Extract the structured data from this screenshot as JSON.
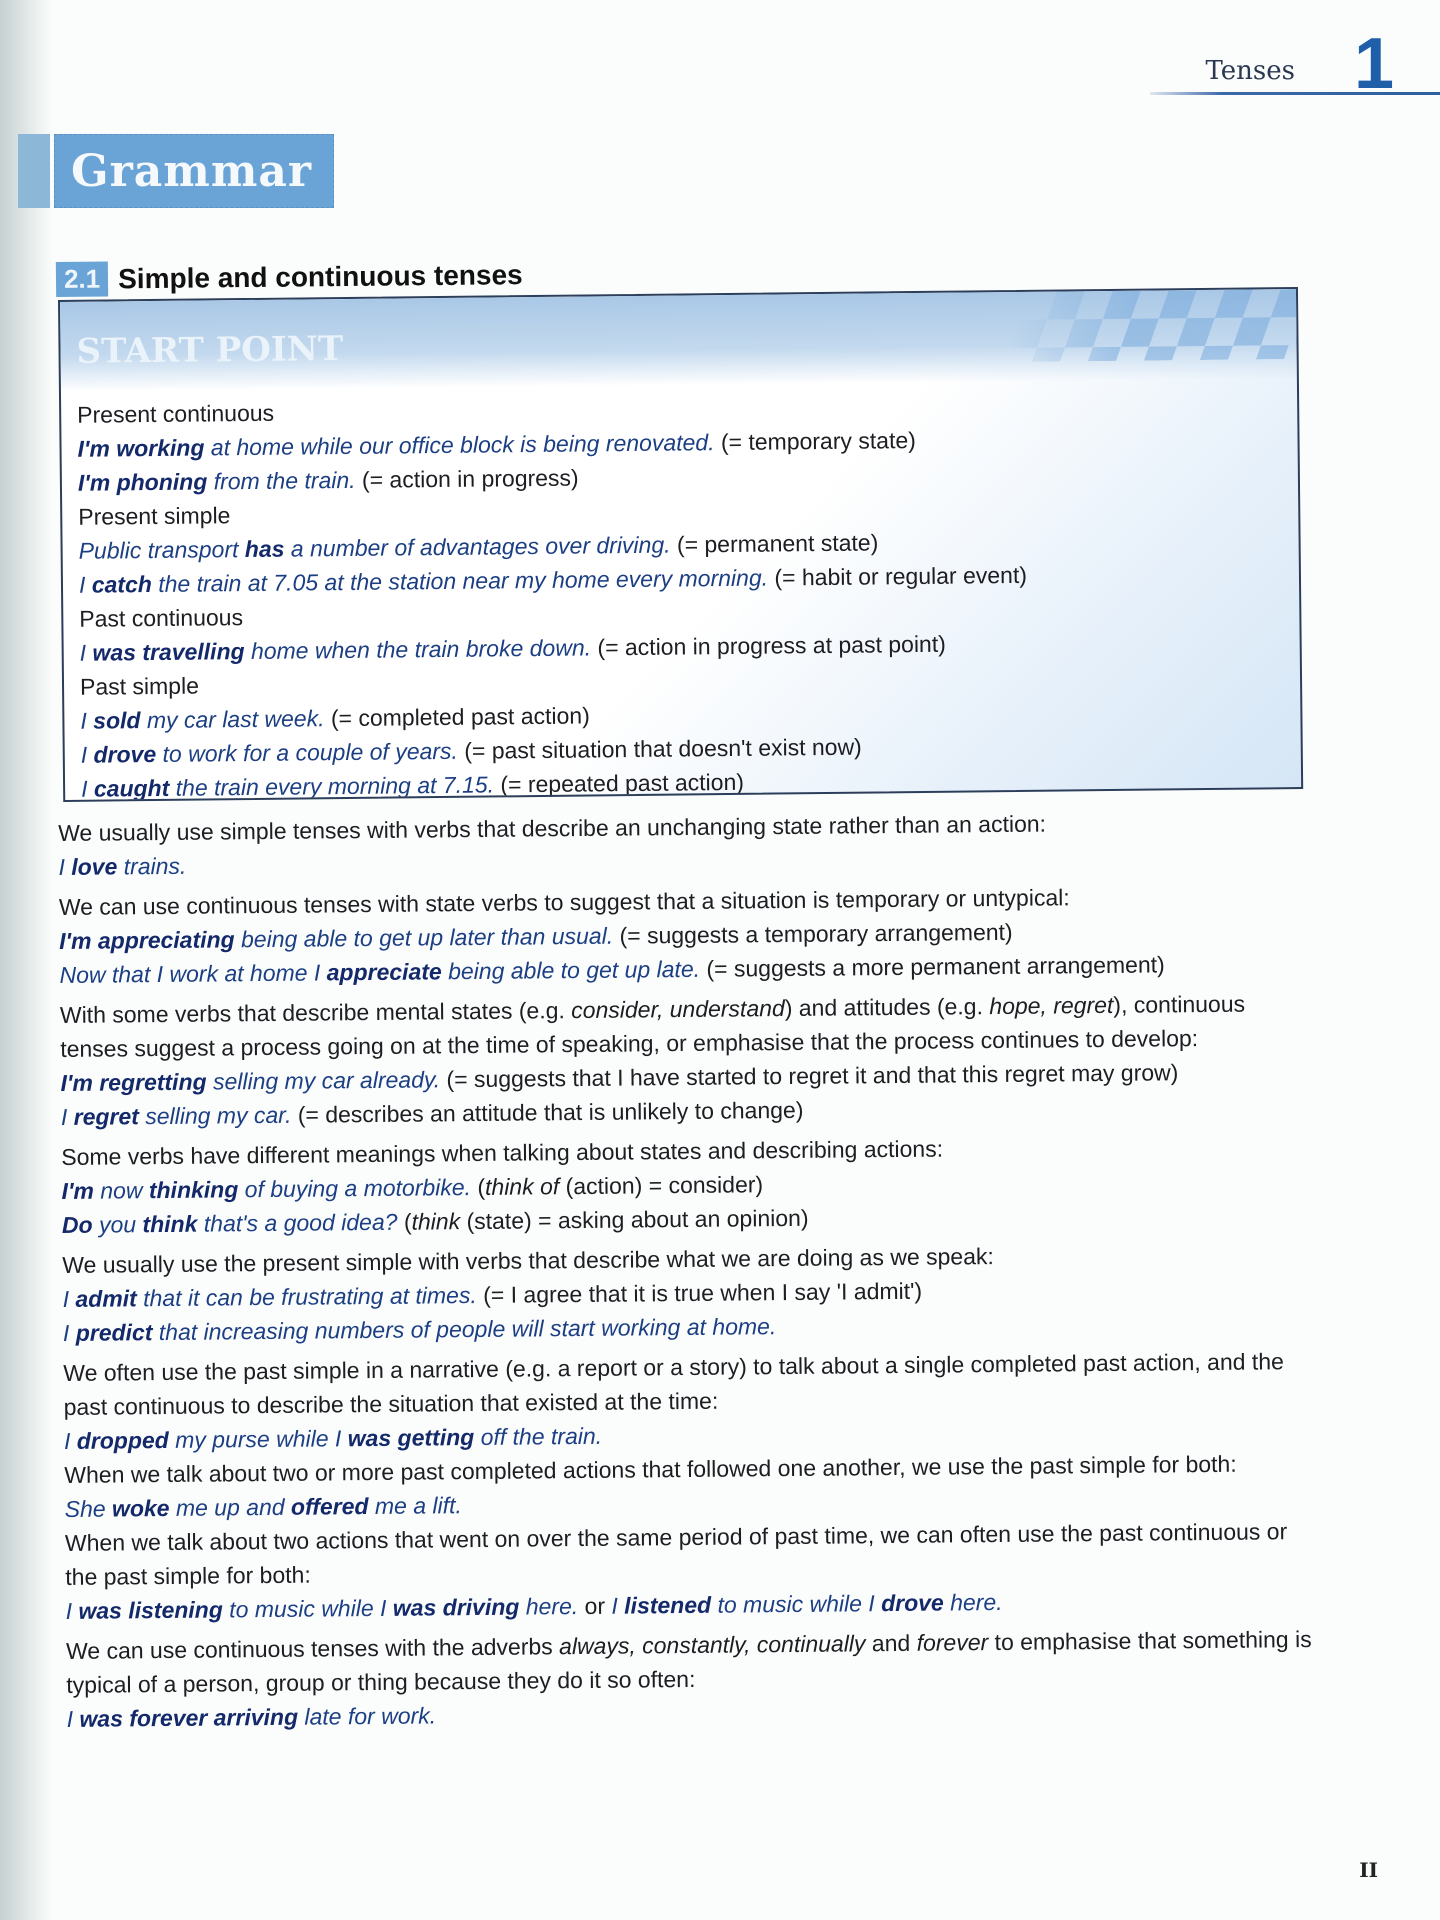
{
  "running_head": {
    "chapter_title": "Tenses",
    "chapter_number": "1"
  },
  "banner": {
    "label": "Grammar"
  },
  "section": {
    "number": "2.1",
    "title": "Simple and continuous tenses"
  },
  "start_point": {
    "title": "START POINT",
    "groups": [
      {
        "category": "Present continuous",
        "examples": [
          {
            "bold": "I'm working",
            "rest": " at home while our office block is being renovated.",
            "gloss": " (= temporary state)"
          },
          {
            "bold": "I'm phoning",
            "rest": " from the train.",
            "gloss": " (= action in progress)"
          }
        ]
      },
      {
        "category": "Present simple",
        "examples": [
          {
            "pre": "Public transport ",
            "bold": "has",
            "rest": " a number of advantages over driving.",
            "gloss": " (= permanent state)"
          },
          {
            "pre": "I ",
            "bold": "catch",
            "rest": " the train at 7.05 at the station near my home every morning.",
            "gloss": " (= habit or regular event)"
          }
        ]
      },
      {
        "category": "Past continuous",
        "examples": [
          {
            "pre": "I ",
            "bold": "was travelling",
            "rest": " home when the train broke down.",
            "gloss": " (= action in progress at past point)"
          }
        ]
      },
      {
        "category": "Past simple",
        "examples": [
          {
            "pre": "I ",
            "bold": "sold",
            "rest": " my car last week.",
            "gloss": " (= completed past action)"
          },
          {
            "pre": "I ",
            "bold": "drove",
            "rest": " to work for a couple of years.",
            "gloss": " (= past situation that doesn't exist now)"
          },
          {
            "pre": "I ",
            "bold": "caught",
            "rest": " the train every morning at 7.15.",
            "gloss": " (= repeated past action)"
          }
        ]
      }
    ]
  },
  "body": {
    "p1": "We usually use simple tenses with verbs that describe an unchanging state rather than an action:",
    "ex1": {
      "pre": "I ",
      "bold": "love",
      "rest": " trains."
    },
    "p2": "We can use continuous tenses with state verbs to suggest that a situation is temporary or untypical:",
    "ex2a": {
      "bold": "I'm appreciating",
      "rest": " being able to get up later than usual.",
      "gloss": " (= suggests a temporary arrangement)"
    },
    "ex2b": {
      "pre": "Now that I work at home I ",
      "bold": "appreciate",
      "rest": " being able to get up late.",
      "gloss": " (= suggests a more permanent arrangement)"
    },
    "p3": {
      "a": "With some verbs that describe mental states (e.g. ",
      "i1": "consider, understand",
      "b": ") and attitudes (e.g. ",
      "i2": "hope, regret",
      "c": "), continuous tenses suggest a process going on at the time of speaking, or emphasise that the process continues to develop:"
    },
    "ex3a": {
      "bold": "I'm regretting",
      "rest": " selling my car already.",
      "gloss": " (= suggests that I have started to regret it and that this regret may grow)"
    },
    "ex3b": {
      "pre": "I ",
      "bold": "regret",
      "rest": " selling my car.",
      "gloss": " (= describes an attitude that is unlikely to change)"
    },
    "p4": "Some verbs have different meanings when talking about states and describing actions:",
    "ex4a": {
      "bold1": "I'm",
      "mid": " now ",
      "bold2": "thinking",
      "rest": " of buying a motorbike.",
      "gloss_pre": " (",
      "gloss_i": "think of",
      "gloss_post": " (action) = consider)"
    },
    "ex4b": {
      "bold1": "Do",
      "mid": " you ",
      "bold2": "think",
      "rest": " that's a good idea?",
      "gloss_pre": " (",
      "gloss_i": "think",
      "gloss_post": " (state) = asking about an opinion)"
    },
    "p5": "We usually use the present simple with verbs that describe what we are doing as we speak:",
    "ex5a": {
      "pre": "I ",
      "bold": "admit",
      "rest": " that it can be frustrating at times.",
      "gloss": " (= I agree that it is true when I say 'I admit')"
    },
    "ex5b": {
      "pre": "I ",
      "bold": "predict",
      "rest": " that increasing numbers of people will start working at home."
    },
    "p6": "We often use the past simple in a narrative (e.g. a report or a story) to talk about a single completed past action, and the past continuous to describe the situation that existed at the time:",
    "ex6": {
      "pre": "I ",
      "bold1": "dropped",
      "mid": " my purse while I ",
      "bold2": "was getting",
      "rest": " off the train."
    },
    "p7": "When we talk about two or more past completed actions that followed one another, we use the past simple for both:",
    "ex7": {
      "pre": "She ",
      "bold1": "woke",
      "mid": " me up and ",
      "bold2": "offered",
      "rest": " me a lift."
    },
    "p8": "When we talk about two actions that went on over the same period of past time, we can often use the past continuous or the past simple for both:",
    "ex8": {
      "pre1": "I ",
      "bold1": "was listening",
      "mid1": " to music while I ",
      "bold2": "was driving",
      "rest1": " here.",
      "or": " or ",
      "pre2": "I ",
      "bold3": "listened",
      "mid2": " to music while I ",
      "bold4": "drove",
      "rest2": " here."
    },
    "p9": {
      "a": "We can use continuous tenses with the adverbs ",
      "i1": "always, constantly, continually",
      "b": " and ",
      "i2": "forever",
      "c": " to emphasise that something is typical of a person, group or thing because they do it so often:"
    },
    "ex9": {
      "pre": "I ",
      "bold": "was forever arriving",
      "rest": " late for work."
    }
  },
  "folio": "II"
}
